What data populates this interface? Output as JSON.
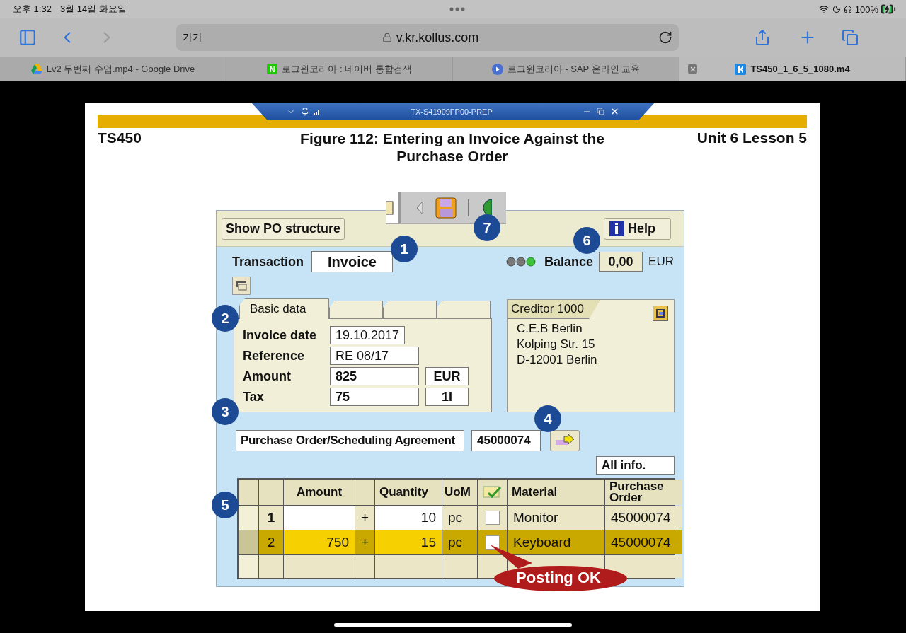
{
  "status_bar": {
    "time": "오후 1:32",
    "date": "3월 14일 화요일",
    "battery": "100%"
  },
  "browser": {
    "text_size": "가가",
    "url": "v.kr.kollus.com"
  },
  "tabs": [
    {
      "title": "Lv2 두번째 수업.mp4 - Google Drive",
      "kind": "drive",
      "selected": false
    },
    {
      "title": "로그윈코리아 : 네이버 통합검색",
      "kind": "naver",
      "icon_label": "N",
      "selected": false
    },
    {
      "title": "로그윈코리아 - SAP 온라인 교육",
      "kind": "play",
      "selected": false
    },
    {
      "title": "TS450_1_6_5_1080.m4",
      "kind": "kollus",
      "selected": true
    }
  ],
  "sap_title_bar": {
    "title": "TX-S41909FP00-PREP"
  },
  "slide": {
    "course": "TS450",
    "figure_title": "Figure 112: Entering an Invoice Against the Purchase Order",
    "unit": "Unit 6 Lesson 5"
  },
  "form": {
    "show_po_button": "Show PO structure",
    "help_button": "Help",
    "transaction_label": "Transaction",
    "transaction_value": "Invoice",
    "balance_label": "Balance",
    "balance_value": "0,00",
    "balance_currency": "EUR",
    "detail_tabs": [
      {
        "label": "Basic data",
        "selected": true
      },
      {
        "selected": false
      },
      {
        "selected": false
      },
      {
        "selected": false
      }
    ],
    "basic_data": [
      {
        "label": "Invoice date",
        "value": "19.10.2017",
        "bold": false
      },
      {
        "label": "Reference",
        "value": "RE 08/17",
        "bold": false
      },
      {
        "label": "Amount",
        "value": "825",
        "unit": "EUR",
        "bold": true
      },
      {
        "label": "Tax",
        "value": "75",
        "unit": "1I",
        "bold": true
      }
    ],
    "creditor": {
      "title": "Creditor 1000",
      "address": [
        "C.E.B Berlin",
        "Kolping Str. 15",
        "D-12001 Berlin"
      ]
    },
    "reference_type": "Purchase Order/Scheduling Agreement",
    "reference_number": "45000074",
    "all_info": "All info.",
    "table": {
      "columns": [
        "Amount",
        "Quantity",
        "UoM",
        "Material",
        "Purchase Order"
      ],
      "rows": [
        {
          "item": "1",
          "sign": "+",
          "quantity": "10",
          "uom": "pc",
          "checked": false,
          "material": "Monitor",
          "purchase_order": "45000074",
          "selected": false
        },
        {
          "item": "2",
          "amount": "750",
          "sign": "+",
          "quantity": "15",
          "uom": "pc",
          "checked": false,
          "material": "Keyboard",
          "purchase_order": "45000074",
          "selected": true
        }
      ]
    }
  },
  "callouts": [
    "1",
    "2",
    "3",
    "4",
    "5",
    "6",
    "7"
  ],
  "posting_note": "Posting OK"
}
